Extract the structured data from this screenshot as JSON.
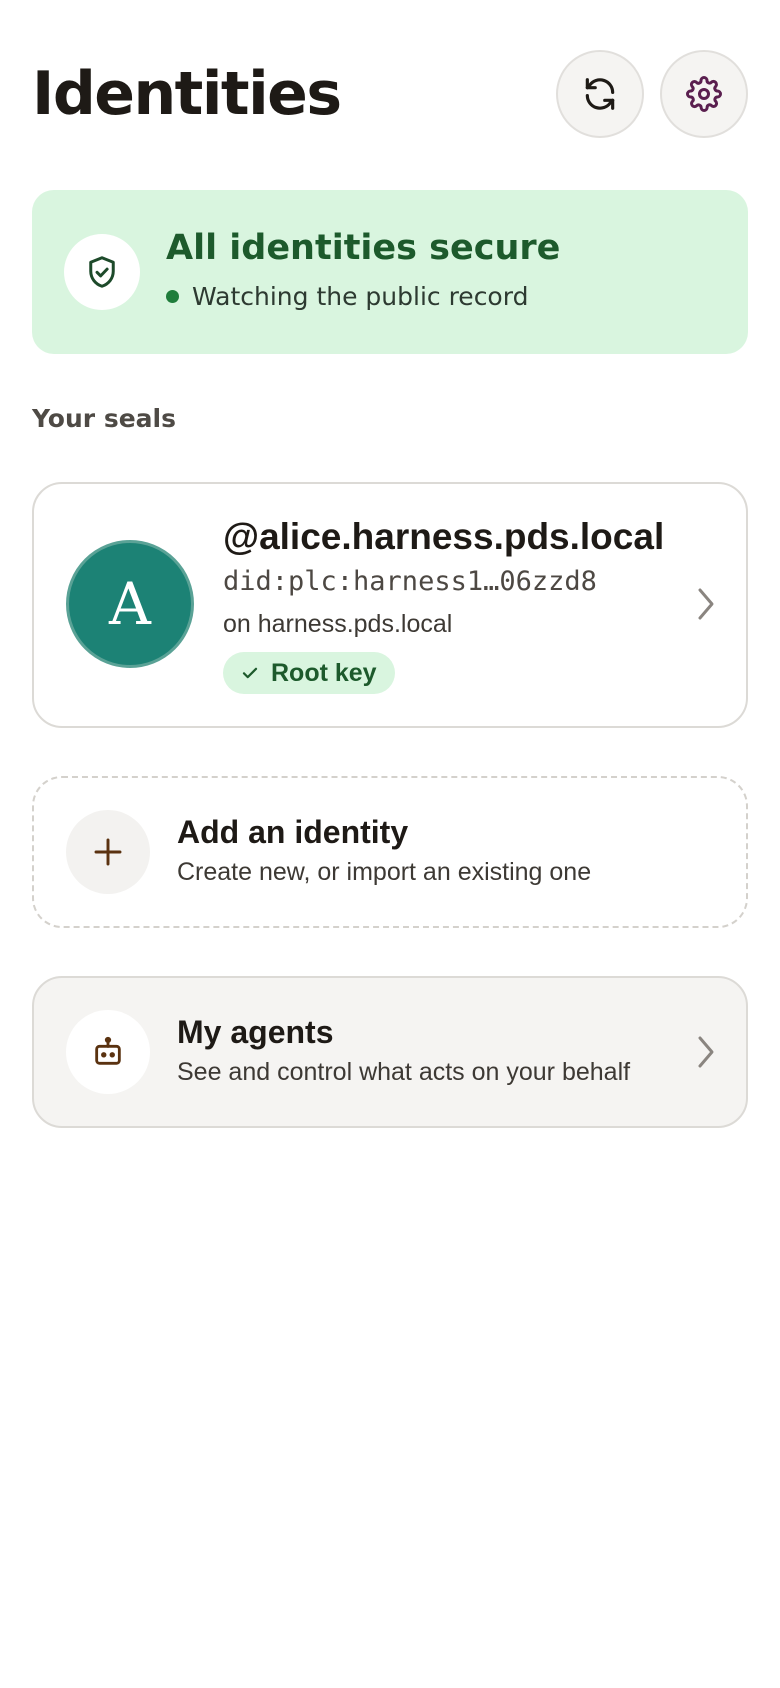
{
  "header": {
    "title": "Identities",
    "refresh_icon": "refresh-icon",
    "settings_icon": "gear-icon"
  },
  "status_banner": {
    "title": "All identities secure",
    "subtitle": "Watching the public record",
    "icon": "shield-check-icon",
    "color": "#d9f5df"
  },
  "section_label": "Your seals",
  "identity": {
    "avatar_initial": "A",
    "handle": "@alice.harness.pds.local",
    "did": "did:plc:harness1…06zzd8",
    "host": "on harness.pds.local",
    "badge": "Root key",
    "avatar_color": "#1c8275"
  },
  "add_identity": {
    "title": "Add an identity",
    "subtitle": "Create new, or import an existing one",
    "icon": "plus-icon"
  },
  "agents": {
    "title": "My agents",
    "subtitle": "See and control what acts on your behalf",
    "icon": "robot-icon"
  }
}
